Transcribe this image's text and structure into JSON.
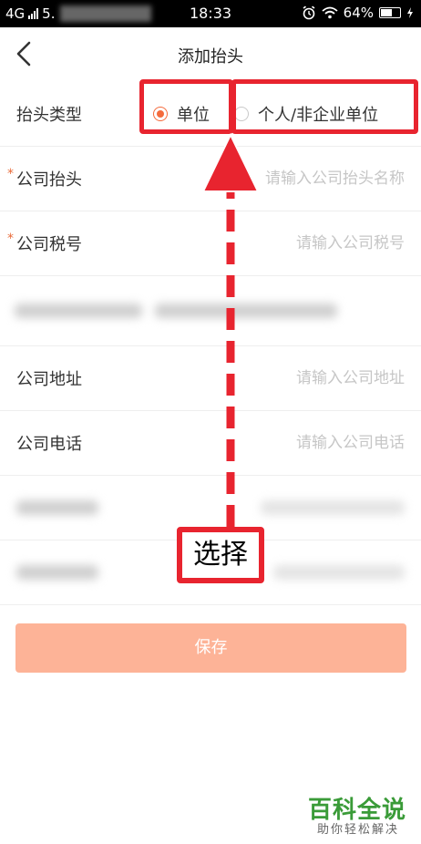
{
  "status_bar": {
    "network": "4G",
    "carrier": "5.",
    "time": "18:33",
    "battery": "64%",
    "battery_level": 0.64
  },
  "header": {
    "title": "添加抬头"
  },
  "form": {
    "type_label": "抬头类型",
    "type_options": [
      "单位",
      "个人/非企业单位"
    ],
    "type_selected": "单位",
    "required_mark": "*",
    "company_name_label": "公司抬头",
    "company_name_placeholder": "请输入公司抬头名称",
    "tax_id_label": "公司税号",
    "tax_id_placeholder": "请输入公司税号",
    "address_label": "公司地址",
    "address_placeholder": "请输入公司地址",
    "phone_label": "公司电话",
    "phone_placeholder": "请输入公司电话"
  },
  "save_label": "保存",
  "annotation": {
    "text": "选择"
  },
  "watermark": {
    "title": "百科全说",
    "subtitle": "助你轻松解决"
  },
  "colors": {
    "accent": "#f46b3c",
    "button": "#fdb397",
    "annotation": "#e8242f",
    "watermark": "#3a9b38"
  }
}
